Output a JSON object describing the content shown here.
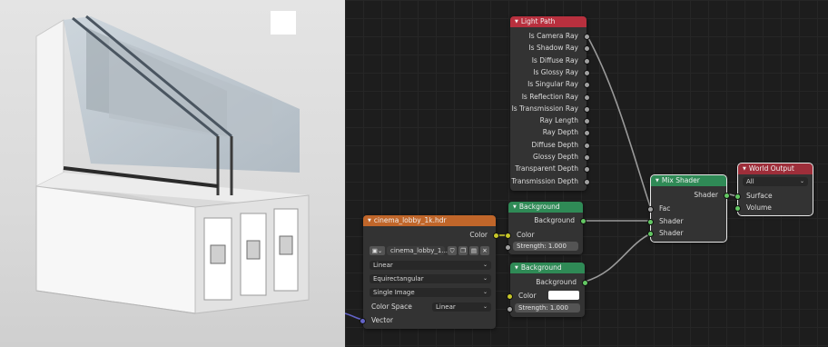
{
  "light_path": {
    "title": "Light Path",
    "outputs": [
      "Is Camera Ray",
      "Is Shadow Ray",
      "Is Diffuse Ray",
      "Is Glossy Ray",
      "Is Singular Ray",
      "Is Reflection Ray",
      "Is Transmission Ray",
      "Ray Length",
      "Ray Depth",
      "Diffuse Depth",
      "Glossy Depth",
      "Transparent Depth",
      "Transmission Depth"
    ]
  },
  "background_1": {
    "title": "Background",
    "output": "Background",
    "color_label": "Color",
    "strength_label": "Strength:",
    "strength_value": "1.000"
  },
  "background_2": {
    "title": "Background",
    "output": "Background",
    "color_label": "Color",
    "strength_label": "Strength:",
    "strength_value": "1.000"
  },
  "env_texture": {
    "title": "cinema_lobby_1k.hdr",
    "output": "Color",
    "image_name": "cinema_lobby_1...",
    "interpolation": "Linear",
    "projection": "Equirectangular",
    "source": "Single Image",
    "color_space_label": "Color Space",
    "color_space_value": "Linear",
    "vector_label": "Vector"
  },
  "mix_shader": {
    "title": "Mix Shader",
    "output": "Shader",
    "inputs": [
      "Fac",
      "Shader",
      "Shader"
    ]
  },
  "world_output": {
    "title": "World Output",
    "target": "All",
    "inputs": [
      "Surface",
      "Volume"
    ]
  },
  "colors": {
    "light_path_header": "#b8303e",
    "background_header": "#2f8a56",
    "texture_header": "#c0662a",
    "output_header": "#9e2e3a",
    "link": "#9a9a9a"
  }
}
